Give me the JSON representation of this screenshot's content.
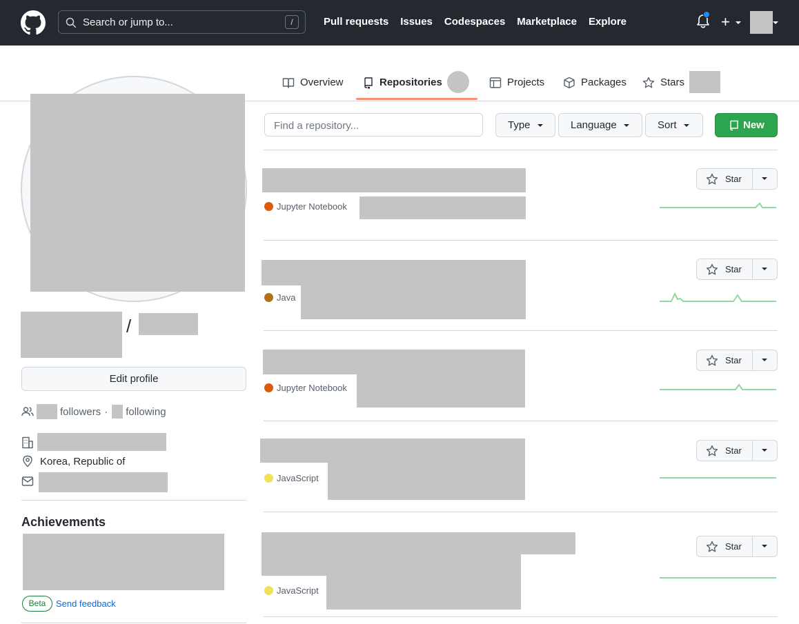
{
  "header": {
    "search_placeholder": "Search or jump to...",
    "search_shortcut": "/",
    "nav": [
      "Pull requests",
      "Issues",
      "Codespaces",
      "Marketplace",
      "Explore"
    ],
    "plus_label": "+"
  },
  "tabs": {
    "overview": "Overview",
    "repositories": "Repositories",
    "projects": "Projects",
    "packages": "Packages",
    "stars": "Stars"
  },
  "profile": {
    "name_separator": "/",
    "edit_button": "Edit profile",
    "followers_label": "followers",
    "middot": "·",
    "following_label": "following",
    "location": "Korea, Republic of",
    "achievements_title": "Achievements",
    "beta_badge": "Beta",
    "feedback_link": "Send feedback"
  },
  "filters": {
    "find_placeholder": "Find a repository...",
    "type_label": "Type",
    "language_label": "Language",
    "sort_label": "Sort",
    "new_label": "New"
  },
  "repos": [
    {
      "language": "Jupyter Notebook",
      "lang_color": "#DA5B0B",
      "star_label": "Star"
    },
    {
      "language": "Java",
      "lang_color": "#b07219",
      "star_label": "Star"
    },
    {
      "language": "Jupyter Notebook",
      "lang_color": "#DA5B0B",
      "star_label": "Star"
    },
    {
      "language": "JavaScript",
      "lang_color": "#f1e05a",
      "star_label": "Star"
    },
    {
      "language": "JavaScript",
      "lang_color": "#f1e05a",
      "star_label": "Star"
    }
  ],
  "colors": {
    "header_bg": "#24292f",
    "accent_underline": "#fd8c73",
    "new_button": "#2da44e",
    "link": "#0969da",
    "sparkline": "#8fd8a2"
  }
}
